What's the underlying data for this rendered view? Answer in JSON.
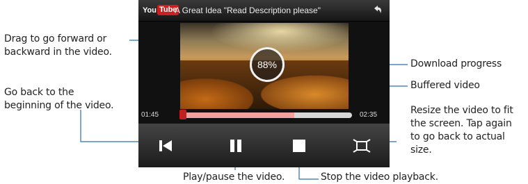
{
  "player": {
    "logo_you": "You",
    "logo_tube": "Tube",
    "title": "A Great Idea \"Read Description please\"",
    "elapsed": "01:45",
    "duration": "02:35",
    "download_progress": "88%",
    "played_fraction": 0.02,
    "buffered_fraction": 0.66
  },
  "icons": {
    "back": "back-arrow-icon",
    "rewind": "skip-to-start-icon",
    "pause": "pause-icon",
    "stop": "stop-icon",
    "resize": "resize-icon"
  },
  "callouts": {
    "drag": [
      "Drag to go forward or",
      "backward in the video."
    ],
    "go_back": [
      "Go back to the",
      "beginning of the video."
    ],
    "download": "Download progress",
    "buffered": "Buffered video",
    "resize": [
      "Resize the video to fit",
      "the screen. Tap again",
      "to go back to actual",
      "size."
    ],
    "play_pause": "Play/pause the video.",
    "stop": "Stop the video playback."
  },
  "colors": {
    "leader_line": "#2a6fb0",
    "played": "#e05050",
    "buffered": "#f2a0a0",
    "logo_red": "#cc1f1f"
  }
}
